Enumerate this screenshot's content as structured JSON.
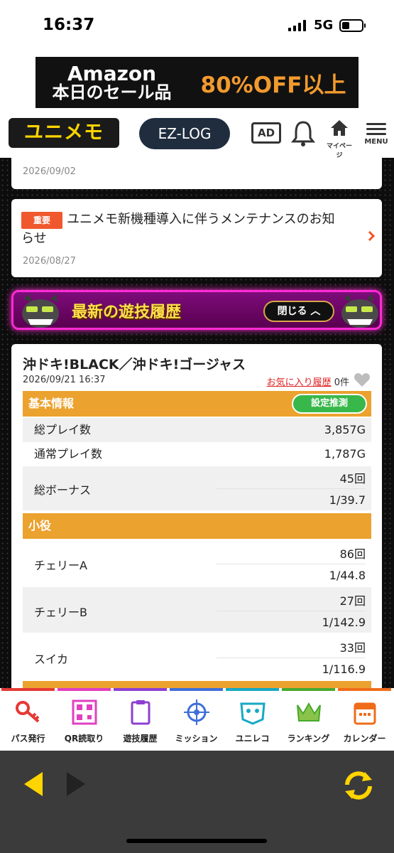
{
  "status": {
    "time": "16:37",
    "network": "5G"
  },
  "ad_banner": {
    "line1": "Amazon",
    "line2": "本日のセール品",
    "offer": "80%OFF以上"
  },
  "header": {
    "logo": "ユニメモ",
    "ezlog": "EZ-LOG",
    "ad_label": "AD",
    "mypage_label": "マイページ",
    "menu_label": "MENU",
    "icons": [
      "bell-icon",
      "home-icon",
      "hamburger-icon"
    ]
  },
  "notices": [
    {
      "date": "2026/09/02"
    },
    {
      "badge": "重要",
      "title": "ユニメモ新機種導入に伴うメンテナンスのお知",
      "title_cont": "らせ",
      "date": "2026/08/27"
    }
  ],
  "promo": {
    "title": "最新の遊技履歴",
    "close_label": "閉じる"
  },
  "log": {
    "machine": "沖ドキ!BLACK／沖ドキ!ゴージャス",
    "date": "2026/09/21 16:37",
    "fav_link": "お気に入り履歴",
    "fav_count": "0件",
    "basic": {
      "header": "基本情報",
      "estimate_button": "設定推測",
      "total_play_label": "総プレイ数",
      "total_play": "3,857G",
      "normal_play_label": "通常プレイ数",
      "normal_play": "1,787G",
      "bonus_label": "総ボーナス",
      "bonus_count": "45回",
      "bonus_prob": "1/39.7"
    },
    "small": {
      "header": "小役",
      "items": [
        {
          "label": "チェリーA",
          "count": "86回",
          "prob": "1/44.8"
        },
        {
          "label": "チェリーB",
          "count": "27回",
          "prob": "1/142.9"
        },
        {
          "label": "スイカ",
          "count": "33回",
          "prob": "1/116.9"
        }
      ]
    }
  },
  "bottom_nav": [
    {
      "label": "パス発行",
      "icon": "key-icon",
      "color": "#e53935"
    },
    {
      "label": "QR読取り",
      "icon": "qr-icon",
      "color": "#e040c0"
    },
    {
      "label": "遊技履歴",
      "icon": "clipboard-icon",
      "color": "#8e3fd1"
    },
    {
      "label": "ミッション",
      "icon": "target-icon",
      "color": "#3f6fd8"
    },
    {
      "label": "ユニレコ",
      "icon": "unireco-icon",
      "color": "#17a9c4"
    },
    {
      "label": "ランキング",
      "icon": "crown-icon",
      "color": "#46a92e"
    },
    {
      "label": "カレンダー",
      "icon": "calendar-icon",
      "color": "#ef6c1a"
    }
  ]
}
